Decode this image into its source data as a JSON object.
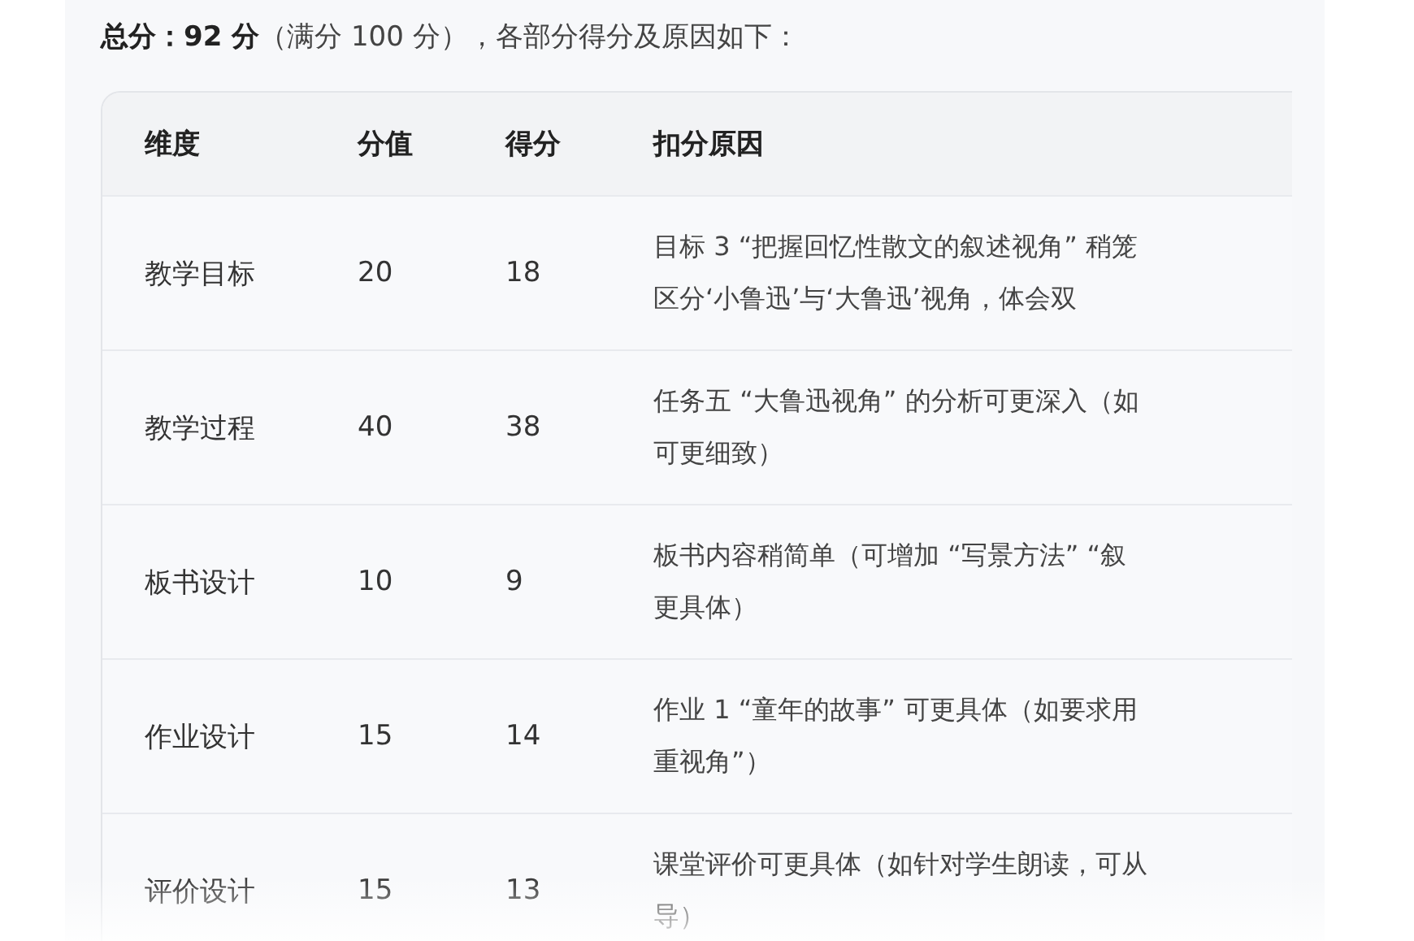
{
  "summary": "**总分：92 分**（满分 100 分），各部分得分及原因如下：",
  "table": {
    "columns": [
      "维度",
      "分值",
      "得分",
      "扣分原因"
    ],
    "rows": [
      {
        "dimension": "教学目标",
        "full": "20",
        "score": "18",
        "reason": [
          "目标 3 “把握回忆性散文的叙述视角” 稍笼",
          "区分‘小鲁迅’与‘大鲁迅’视角，体会双"
        ]
      },
      {
        "dimension": "教学过程",
        "full": "40",
        "score": "38",
        "reason": [
          "任务五 “大鲁迅视角” 的分析可更深入（如",
          "可更细致）"
        ]
      },
      {
        "dimension": "板书设计",
        "full": "10",
        "score": "9",
        "reason": [
          "板书内容稍简单（可增加 “写景方法” “叙",
          "更具体）"
        ]
      },
      {
        "dimension": "作业设计",
        "full": "15",
        "score": "14",
        "reason": [
          "作业 1 “童年的故事” 可更具体（如要求用",
          "重视角”）"
        ]
      },
      {
        "dimension": "评价设计",
        "full": "15",
        "score": "13",
        "reason": [
          "课堂评价可更具体（如针对学生朗读，可从",
          "导）"
        ]
      }
    ]
  }
}
